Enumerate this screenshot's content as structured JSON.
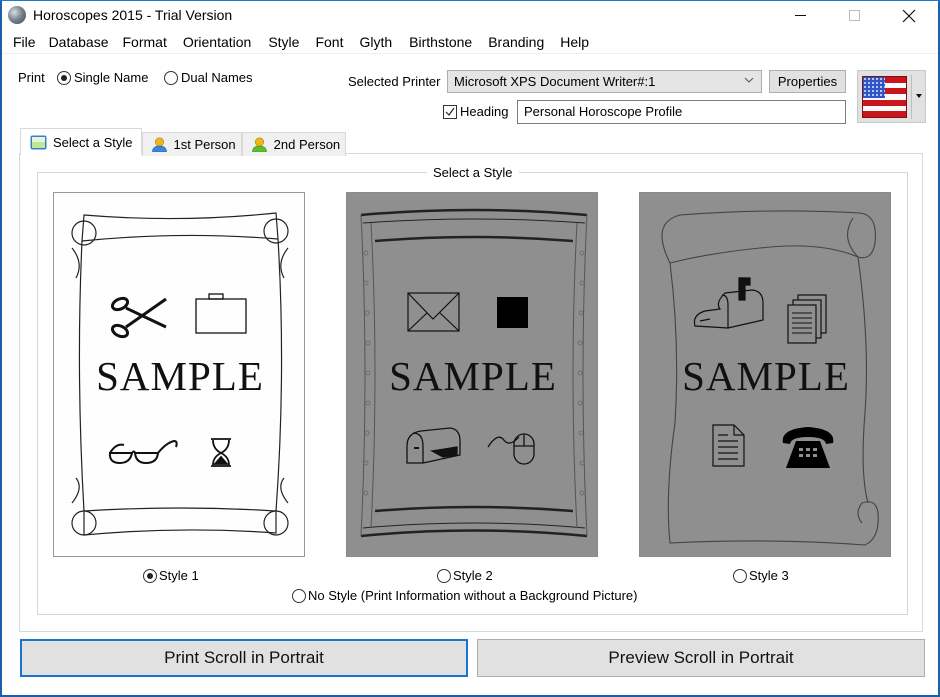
{
  "window": {
    "title": "Horoscopes 2015 - Trial Version",
    "controls": {
      "minimize": "minimize",
      "maximize": "maximize",
      "close": "close"
    }
  },
  "menu": {
    "items": [
      "File",
      "Database",
      "Format",
      "Orientation",
      "Style",
      "Font",
      "Glyth",
      "Birthstone",
      "Branding",
      "Help"
    ]
  },
  "print": {
    "label": "Print",
    "options": [
      {
        "label": "Single Name",
        "checked": true
      },
      {
        "label": "Dual Names",
        "checked": false
      }
    ]
  },
  "printer": {
    "label": "Selected Printer",
    "selected": "Microsoft XPS Document Writer#:1",
    "properties_label": "Properties"
  },
  "heading": {
    "checkbox_label": "Heading",
    "checked": true,
    "value": "Personal Horoscope Profile"
  },
  "language": {
    "flag": "us-flag"
  },
  "tabs": [
    {
      "label": "Select a Style",
      "icon": "picture-icon",
      "active": true
    },
    {
      "label": "1st Person",
      "icon": "user-blue-icon",
      "active": false
    },
    {
      "label": "2nd Person",
      "icon": "user-green-icon",
      "active": false
    }
  ],
  "style_group": {
    "title": "Select a Style",
    "styles": [
      {
        "label": "Style 1",
        "checked": true,
        "sample": "SAMPLE",
        "glyphs": [
          "scissors",
          "briefcase",
          "glasses",
          "hourglass"
        ]
      },
      {
        "label": "Style 2",
        "checked": false,
        "sample": "SAMPLE",
        "glyphs": [
          "envelope",
          "black-square",
          "mailbox",
          "mouse"
        ]
      },
      {
        "label": "Style 3",
        "checked": false,
        "sample": "SAMPLE",
        "glyphs": [
          "mailbox-open",
          "documents",
          "document",
          "telephone"
        ]
      }
    ],
    "no_style": {
      "label": "No Style (Print Information without a Background Picture)",
      "checked": false
    }
  },
  "actions": {
    "print": "Print Scroll in Portrait",
    "preview": "Preview Scroll in Portrait"
  }
}
